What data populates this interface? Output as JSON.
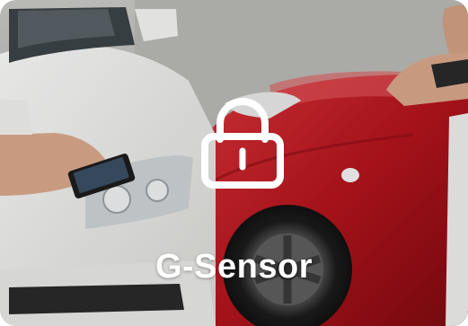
{
  "feature": {
    "label": "G-Sensor",
    "icon": "lock-icon"
  },
  "colors": {
    "white_car": "#f2f2f0",
    "red_car": "#b3141c",
    "overlay_icon": "#ffffff",
    "label_text": "#ffffff"
  }
}
